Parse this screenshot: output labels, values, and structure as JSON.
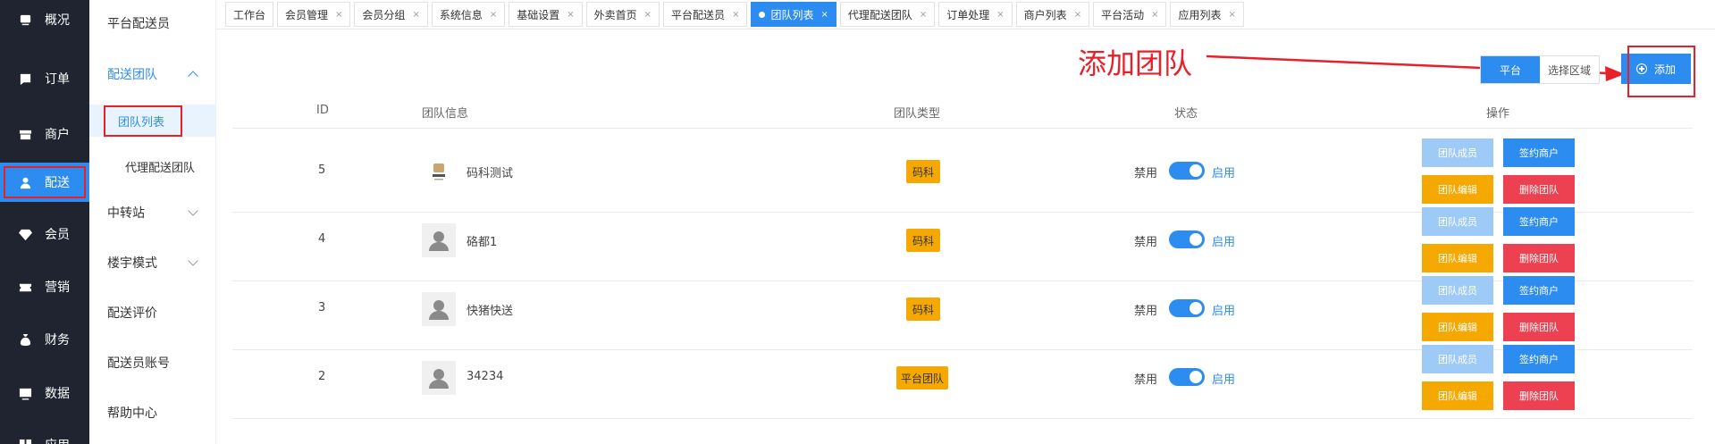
{
  "nav": {
    "items": [
      {
        "label": "概况",
        "icon": "overview-icon"
      },
      {
        "label": "订单",
        "icon": "order-icon"
      },
      {
        "label": "商户",
        "icon": "store-icon"
      },
      {
        "label": "配送",
        "icon": "delivery-user-icon"
      },
      {
        "label": "会员",
        "icon": "member-diamond-icon"
      },
      {
        "label": "营销",
        "icon": "marketing-ticket-icon"
      },
      {
        "label": "财务",
        "icon": "finance-bag-icon"
      },
      {
        "label": "数据",
        "icon": "data-monitor-icon"
      },
      {
        "label": "应用",
        "icon": "app-icon"
      }
    ],
    "active_index": 3
  },
  "submenu": {
    "items": [
      {
        "label": "平台配送员"
      },
      {
        "label": "配送团队"
      },
      {
        "label": "团队列表"
      },
      {
        "label": "代理配送团队"
      },
      {
        "label": "中转站"
      },
      {
        "label": "楼宇模式"
      },
      {
        "label": "配送评价"
      },
      {
        "label": "配送员账号"
      },
      {
        "label": "帮助中心"
      }
    ]
  },
  "tabs": [
    {
      "label": "工作台",
      "closable": false
    },
    {
      "label": "会员管理",
      "closable": true
    },
    {
      "label": "会员分组",
      "closable": true
    },
    {
      "label": "系统信息",
      "closable": true
    },
    {
      "label": "基础设置",
      "closable": true
    },
    {
      "label": "外卖首页",
      "closable": true
    },
    {
      "label": "平台配送员",
      "closable": true
    },
    {
      "label": "团队列表",
      "closable": true,
      "active": true
    },
    {
      "label": "代理配送团队",
      "closable": true
    },
    {
      "label": "订单处理",
      "closable": true
    },
    {
      "label": "商户列表",
      "closable": true
    },
    {
      "label": "平台活动",
      "closable": true
    },
    {
      "label": "应用列表",
      "closable": true
    }
  ],
  "tab_close_glyph": "×",
  "annotation": {
    "text": "添加团队",
    "color": "#e8202a"
  },
  "toolbar": {
    "segment": [
      "平台",
      "选择区域"
    ],
    "add_label": "添加"
  },
  "table": {
    "headers": {
      "id": "ID",
      "info": "团队信息",
      "type": "团队类型",
      "status": "状态",
      "actions": "操作"
    },
    "status_off_label": "禁用",
    "status_on_label": "启用",
    "action_labels": [
      "团队成员",
      "签约商户",
      "团队编辑",
      "删除团队"
    ],
    "rows": [
      {
        "id": "5",
        "name": "码科测试",
        "type": "码科",
        "avatar": "logo",
        "enabled": true
      },
      {
        "id": "4",
        "name": "硌都1",
        "type": "码科",
        "avatar": "default",
        "enabled": true
      },
      {
        "id": "3",
        "name": "快猪快送",
        "type": "码科",
        "avatar": "default",
        "enabled": true
      },
      {
        "id": "2",
        "name": "34234",
        "type": "平台团队",
        "avatar": "default",
        "enabled": true
      }
    ]
  },
  "colors": {
    "primary": "#2d8cf0",
    "nav_bg": "#1f2430",
    "tag": "#f5a800",
    "danger": "#ed4050",
    "annotation": "#e8202a"
  }
}
